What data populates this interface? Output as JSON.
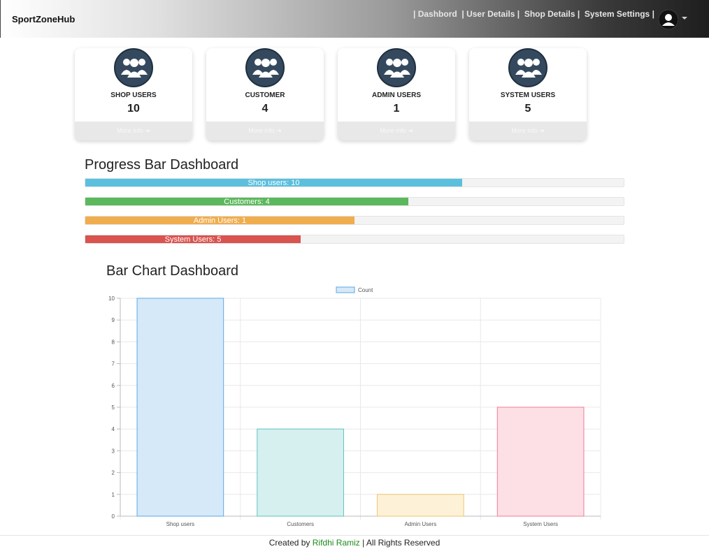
{
  "navbar": {
    "brand": "SportZoneHub",
    "links": [
      "Dashbord",
      "User Details",
      "Shop Details",
      "System Settings"
    ]
  },
  "cards": [
    {
      "title": "SHOP USERS",
      "count": "10",
      "more": "More info"
    },
    {
      "title": "CUSTOMER",
      "count": "4",
      "more": "More info"
    },
    {
      "title": "ADMIN USERS",
      "count": "1",
      "more": "More info"
    },
    {
      "title": "SYSTEM USERS",
      "count": "5",
      "more": "More info"
    }
  ],
  "progress": {
    "title": "Progress Bar Dashboard",
    "bars": [
      {
        "label": "Shop users: 10",
        "percent": 70,
        "color": "#5bc0de"
      },
      {
        "label": "Customers: 4",
        "percent": 60,
        "color": "#5cb85c"
      },
      {
        "label": "Admin Users: 1",
        "percent": 50,
        "color": "#f0ad4e"
      },
      {
        "label": "System Users: 5",
        "percent": 40,
        "color": "#d9534f"
      }
    ]
  },
  "bar_section": {
    "title": "Bar Chart Dashboard"
  },
  "chart_data": {
    "type": "bar",
    "categories": [
      "Shop users",
      "Customers",
      "Admin Users",
      "System Users"
    ],
    "series": [
      {
        "name": "Count",
        "values": [
          10,
          4,
          1,
          5
        ]
      }
    ],
    "ylim": [
      0,
      10
    ],
    "yticks": [
      0,
      1,
      2,
      3,
      4,
      5,
      6,
      7,
      8,
      9,
      10
    ],
    "legend": "top",
    "grid": true,
    "bar_colors": [
      "#d6e9f8",
      "#d6f0ef",
      "#fdf2d8",
      "#fde0e6"
    ],
    "border_colors": [
      "#5aa9e6",
      "#5cc4c0",
      "#f2c46d",
      "#f27a97"
    ]
  },
  "footer": {
    "prefix": "Created by ",
    "author": "Rifdhi Ramiz",
    "suffix": " | All Rights Reserved"
  }
}
